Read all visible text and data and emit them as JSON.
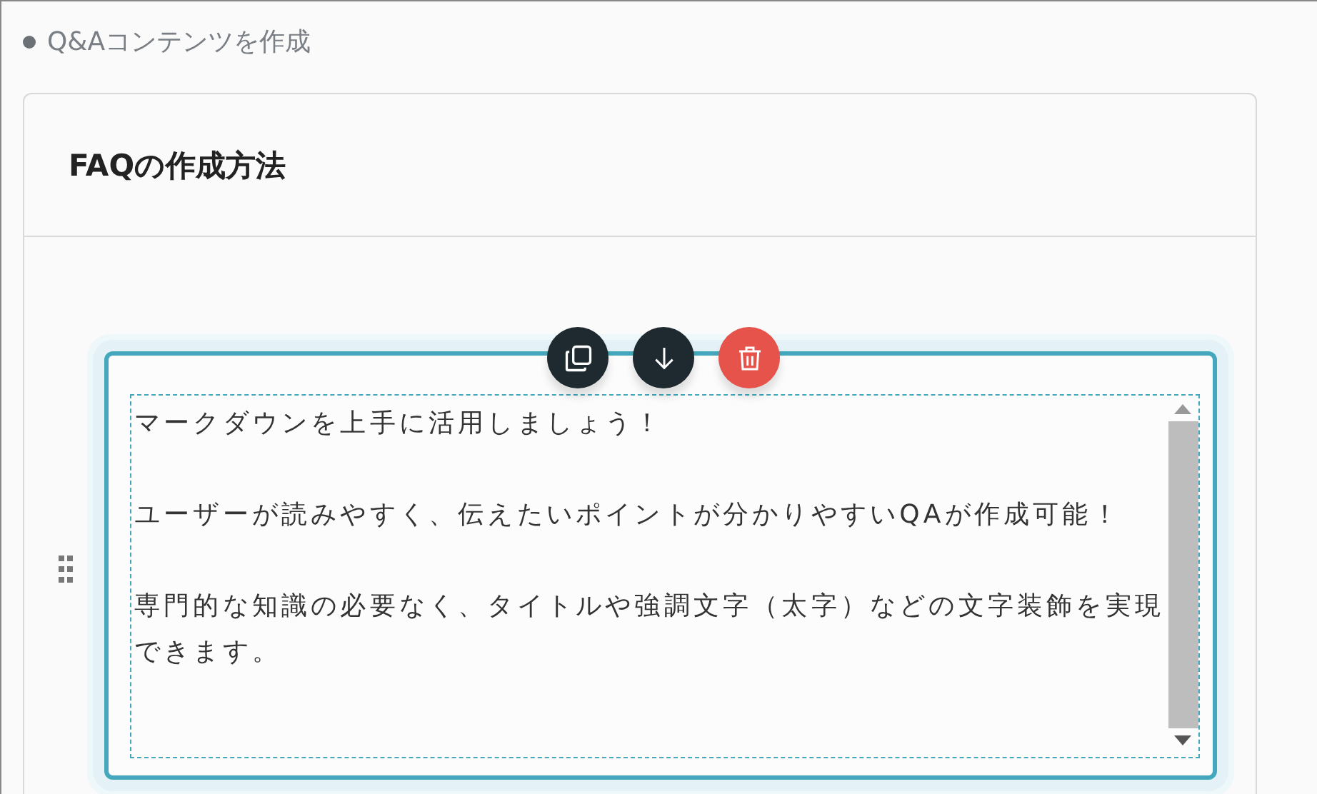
{
  "section_label": "Q&Aコンテンツを作成",
  "card": {
    "title": "FAQの作成方法"
  },
  "editor": {
    "tools": [
      {
        "kind": "copy"
      },
      {
        "kind": "down"
      },
      {
        "kind": "delete"
      }
    ],
    "paragraphs": [
      "マークダウンを上手に活用しましょう！",
      "ユーザーが読みやすく、伝えたいポイントが分かりやすいQAが作成可能！",
      "専門的な知識の必要なく、タイトルや強調文字（太字）などの文字装飾を実現できます。"
    ]
  }
}
